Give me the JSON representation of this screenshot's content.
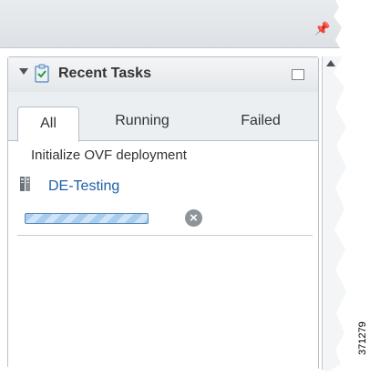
{
  "panel": {
    "title": "Recent Tasks",
    "tabs": [
      "All",
      "Running",
      "Failed"
    ],
    "active_tab": "All"
  },
  "task": {
    "title": "Initialize OVF deployment",
    "target": "DE-Testing"
  },
  "figure_id": "371279",
  "colors": {
    "link": "#1f5fa8",
    "progress_fill": "#a8cdee",
    "progress_border": "#5d8ab6"
  },
  "icons": [
    "pin-icon",
    "collapse-arrow-icon",
    "clipboard-check-icon",
    "maximize-icon",
    "host-icon",
    "cancel-icon",
    "scroll-up-icon"
  ]
}
